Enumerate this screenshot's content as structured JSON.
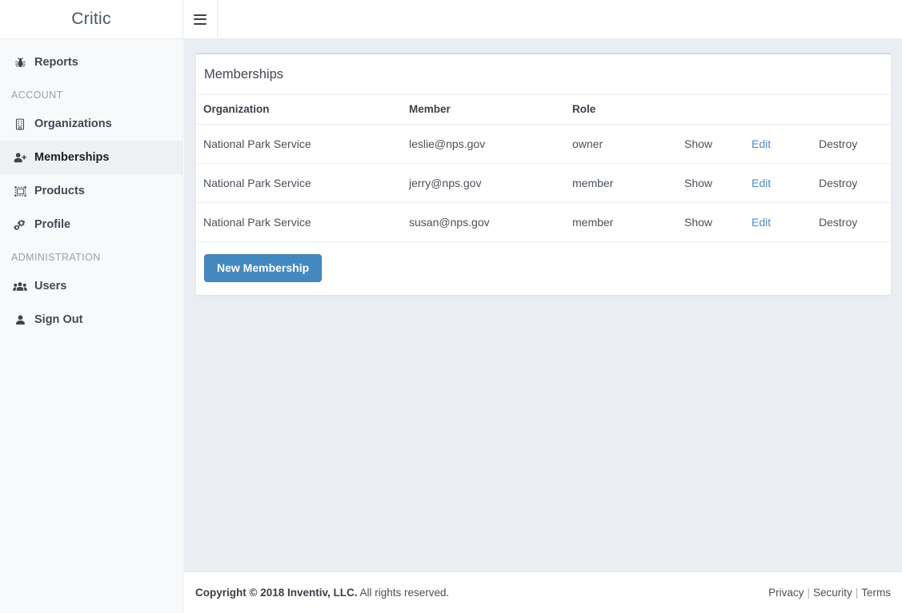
{
  "brand": {
    "name": "Critic"
  },
  "topbar": {
    "menu_icon": "hamburger-icon"
  },
  "sidebar": {
    "primary": [
      {
        "label": "Reports",
        "icon": "bug-icon",
        "active": false
      }
    ],
    "sections": [
      {
        "title": "ACCOUNT",
        "items": [
          {
            "label": "Organizations",
            "icon": "building-icon",
            "active": false
          },
          {
            "label": "Memberships",
            "icon": "user-plus-icon",
            "active": true
          },
          {
            "label": "Products",
            "icon": "object-group-icon",
            "active": false
          },
          {
            "label": "Profile",
            "icon": "cogs-icon",
            "active": false
          }
        ]
      },
      {
        "title": "ADMINISTRATION",
        "items": [
          {
            "label": "Users",
            "icon": "users-icon",
            "active": false
          },
          {
            "label": "Sign Out",
            "icon": "user-icon",
            "active": false
          }
        ]
      }
    ]
  },
  "card": {
    "title": "Memberships",
    "columns": [
      "Organization",
      "Member",
      "Role"
    ],
    "rows": [
      {
        "organization": "National Park Service",
        "member": "leslie@nps.gov",
        "role": "owner",
        "show": "Show",
        "edit": "Edit",
        "destroy": "Destroy"
      },
      {
        "organization": "National Park Service",
        "member": "jerry@nps.gov",
        "role": "member",
        "show": "Show",
        "edit": "Edit",
        "destroy": "Destroy"
      },
      {
        "organization": "National Park Service",
        "member": "susan@nps.gov",
        "role": "member",
        "show": "Show",
        "edit": "Edit",
        "destroy": "Destroy"
      }
    ],
    "new_button": "New Membership"
  },
  "footer": {
    "copyright_bold": "Copyright © 2018 Inventiv, LLC.",
    "copyright_rest": " All rights reserved.",
    "links": [
      "Privacy",
      "Security",
      "Terms"
    ],
    "separator": "|"
  },
  "colors": {
    "accent": "#4389c0",
    "link": "#4b8bc8",
    "page_bg": "#eaedf1",
    "sidebar_bg": "#f8f9fa",
    "text": "#4a5159"
  }
}
